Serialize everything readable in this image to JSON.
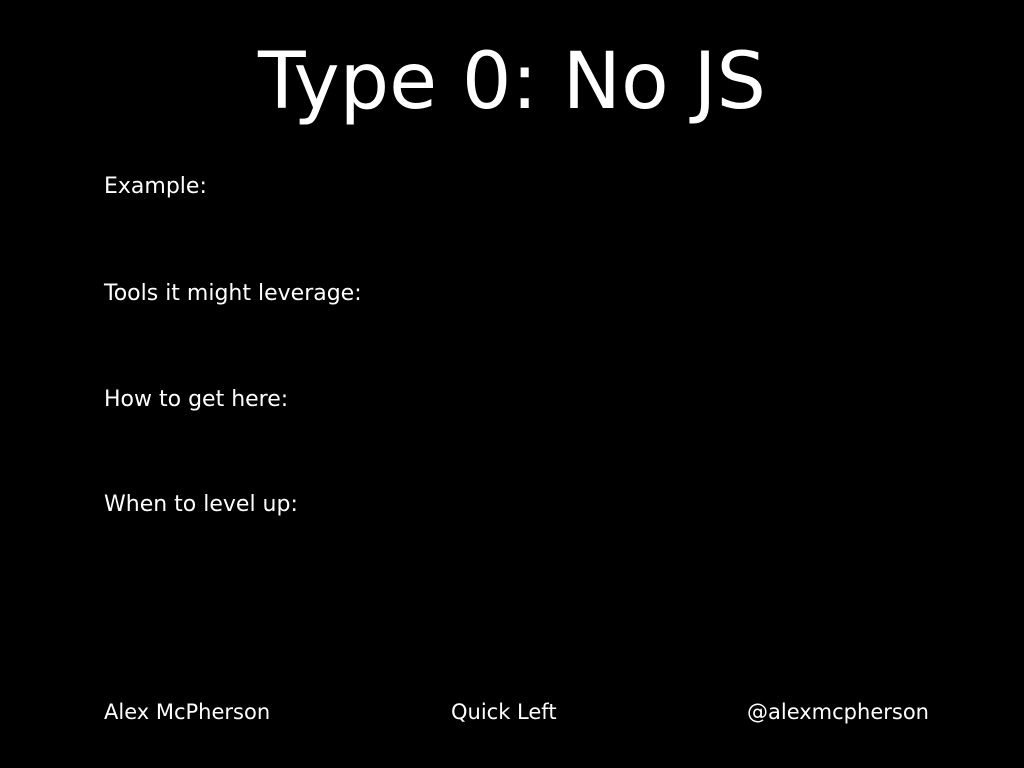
{
  "slide": {
    "title": "Type 0: No JS",
    "prompts": [
      "Example:",
      "Tools it might leverage:",
      "How to get here:",
      "When to level up:"
    ]
  },
  "footer": {
    "author": "Alex McPherson",
    "company": "Quick Left",
    "handle": "@alexmcpherson"
  },
  "colors": {
    "background": "#000000",
    "text": "#ffffff"
  }
}
